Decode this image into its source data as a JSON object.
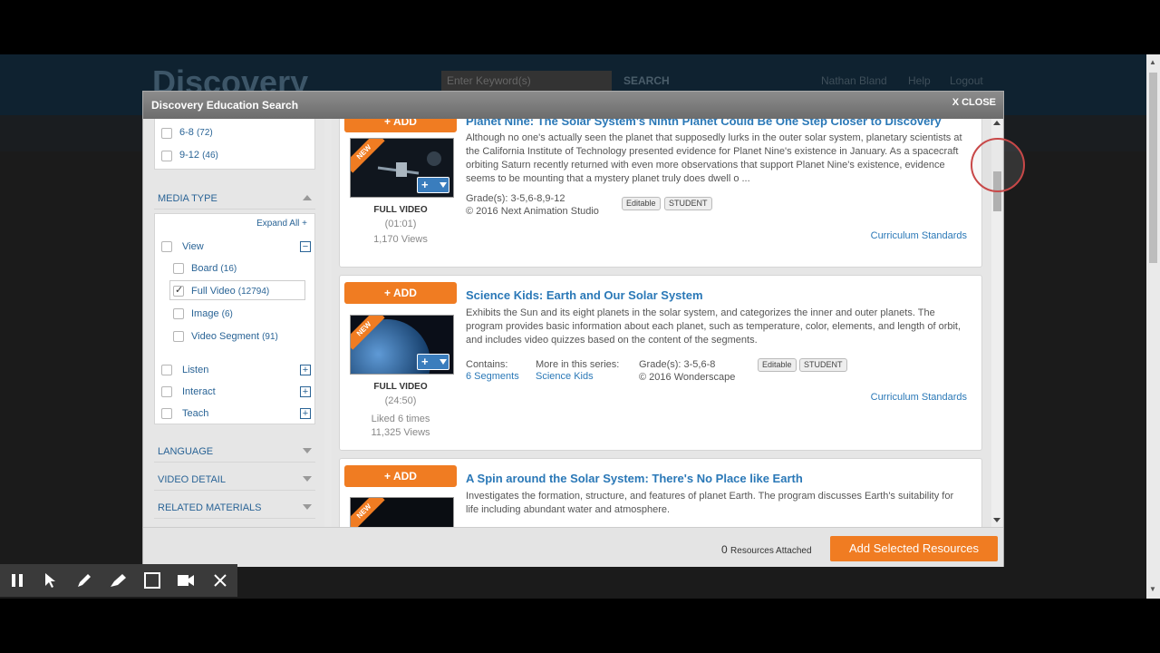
{
  "background": {
    "logo": "Discovery",
    "search_placeholder": "Enter Keyword(s)",
    "search_button": "SEARCH",
    "user": "Nathan Bland",
    "help": "Help",
    "logout": "Logout"
  },
  "modal": {
    "title": "Discovery Education Search",
    "close": "X CLOSE"
  },
  "sidebar": {
    "grades": [
      {
        "label": "6-8",
        "count": "(72)"
      },
      {
        "label": "9-12",
        "count": "(46)"
      }
    ],
    "media_type_title": "MEDIA TYPE",
    "expand_all": "Expand All +",
    "view_label": "View",
    "view_items": [
      {
        "label": "Board",
        "count": "(16)",
        "checked": false
      },
      {
        "label": "Full Video",
        "count": "(12794)",
        "checked": true
      },
      {
        "label": "Image",
        "count": "(6)",
        "checked": false
      },
      {
        "label": "Video Segment",
        "count": "(91)",
        "checked": false
      }
    ],
    "other_types": [
      "Listen",
      "Interact",
      "Teach"
    ],
    "language": "LANGUAGE",
    "video_detail": "VIDEO DETAIL",
    "related_materials": "RELATED MATERIALS"
  },
  "results": [
    {
      "add": "+ ADD",
      "new": "NEW",
      "media_type": "FULL VIDEO",
      "duration": "(01:01)",
      "views": "1,170 Views",
      "title": "Planet Nine: The Solar System's Ninth Planet Could Be One Step Closer to Discovery",
      "description": "Although no one's actually seen the planet that supposedly lurks in the outer solar system, planetary scientists at the California Institute of Technology presented evidence for Planet Nine's existence in January. As a spacecraft orbiting Saturn recently returned with even more observations that support Planet Nine's existence, evidence seems to be mounting that a mystery planet truly does dwell o ...",
      "grades": "Grade(s): 3-5,6-8,9-12",
      "copyright": "© 2016 Next Animation Studio",
      "tags": [
        "Editable",
        "STUDENT"
      ],
      "standards": "Curriculum Standards"
    },
    {
      "add": "+ ADD",
      "new": "NEW",
      "media_type": "FULL VIDEO",
      "duration": "(24:50)",
      "liked": "Liked 6 times",
      "views": "11,325 Views",
      "title": "Science Kids: Earth and Our Solar System",
      "description": "Exhibits the Sun and its eight planets in the solar system, and categorizes the inner and outer planets. The program provides basic information about each planet, such as temperature, color, elements, and length of orbit, and includes video quizzes based on the content of the segments.",
      "contains_label": "Contains:",
      "contains_value": "6 Segments",
      "series_label": "More in this series:",
      "series_value": "Science Kids",
      "grades": "Grade(s): 3-5,6-8",
      "copyright": "© 2016 Wonderscape",
      "tags": [
        "Editable",
        "STUDENT"
      ],
      "standards": "Curriculum Standards"
    },
    {
      "add": "+ ADD",
      "new": "NEW",
      "title": "A Spin around the Solar System: There's No Place like Earth",
      "description": "Investigates the formation, structure, and features of planet Earth. The program discusses Earth's suitability for life including abundant water and atmosphere."
    }
  ],
  "footer": {
    "count": "0",
    "attached_label": "Resources Attached",
    "add_selected": "Add Selected Resources"
  },
  "colors": {
    "accent": "#f07c22",
    "link": "#2a78b7"
  },
  "icons": [
    "pause-icon",
    "pointer-icon",
    "pen-icon",
    "highlighter-icon",
    "rectangle-icon",
    "camera-icon",
    "close-icon"
  ]
}
